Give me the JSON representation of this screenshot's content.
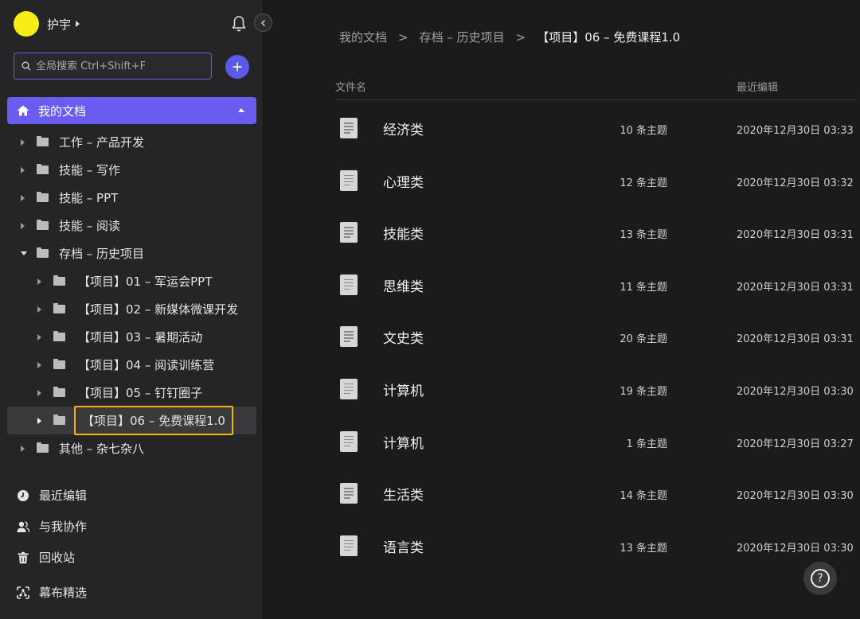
{
  "user": {
    "name": "护宇"
  },
  "search": {
    "placeholder": "全局搜索 Ctrl+Shift+F"
  },
  "sidebar": {
    "root_label": "我的文档",
    "tree": [
      {
        "label": "工作 – 产品开发"
      },
      {
        "label": "技能 – 写作"
      },
      {
        "label": "技能 – PPT"
      },
      {
        "label": "技能 – 阅读"
      },
      {
        "label": "存档 – 历史项目"
      },
      {
        "label": "【项目】01 – 军运会PPT"
      },
      {
        "label": "【项目】02 – 新媒体微课开发"
      },
      {
        "label": "【项目】03 – 暑期活动"
      },
      {
        "label": "【项目】04 – 阅读训练营"
      },
      {
        "label": "【项目】05 – 钉钉圈子"
      },
      {
        "label": "【项目】06 – 免费课程1.0"
      },
      {
        "label": "其他 – 杂七杂八"
      }
    ],
    "bottom": [
      {
        "label": "最近编辑"
      },
      {
        "label": "与我协作"
      },
      {
        "label": "回收站"
      },
      {
        "label": "幕布精选"
      }
    ]
  },
  "breadcrumb": {
    "items": [
      "我的文档",
      "存档 – 历史项目",
      "【项目】06 – 免费课程1.0"
    ],
    "separator": ">"
  },
  "table": {
    "col_name": "文件名",
    "col_edit": "最近编辑",
    "rows": [
      {
        "name": "经济类",
        "count": "10 条主题",
        "time": "2020年12月30日 03:33"
      },
      {
        "name": "心理类",
        "count": "12 条主题",
        "time": "2020年12月30日 03:32"
      },
      {
        "name": "技能类",
        "count": "13 条主题",
        "time": "2020年12月30日 03:31"
      },
      {
        "name": "思维类",
        "count": "11 条主题",
        "time": "2020年12月30日 03:31"
      },
      {
        "name": "文史类",
        "count": "20 条主题",
        "time": "2020年12月30日 03:31"
      },
      {
        "name": "计算机",
        "count": "19 条主题",
        "time": "2020年12月30日 03:30"
      },
      {
        "name": "计算机",
        "count": "1 条主题",
        "time": "2020年12月30日 03:27"
      },
      {
        "name": "生活类",
        "count": "14 条主题",
        "time": "2020年12月30日 03:30"
      },
      {
        "name": "语言类",
        "count": "13 条主题",
        "time": "2020年12月30日 03:30"
      }
    ]
  },
  "help": {
    "label": "?"
  },
  "colors": {
    "accent": "#6a5cf0",
    "highlight": "#f2b705",
    "avatar": "#f6ec16"
  }
}
